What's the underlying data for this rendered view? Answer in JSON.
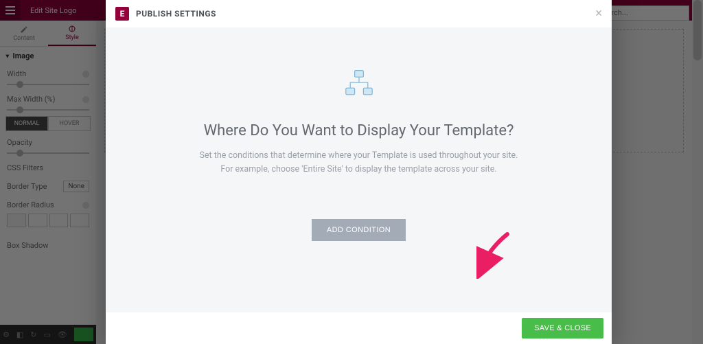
{
  "editor": {
    "title": "Edit Site Logo",
    "tabs": {
      "content": "Content",
      "style": "Style"
    },
    "section_image": "Image",
    "width_label": "Width",
    "max_width_label": "Max Width (%)",
    "normal_tab": "NORMAL",
    "hover_tab": "HOVER",
    "opacity_label": "Opacity",
    "css_filters_label": "CSS Filters",
    "border_type_label": "Border Type",
    "border_type_value": "None",
    "border_radius_label": "Border Radius",
    "box_shadow_label": "Box Shadow",
    "search_placeholder": "Search..."
  },
  "modal": {
    "title": "PUBLISH SETTINGS",
    "headline": "Where Do You Want to Display Your Template?",
    "sub1": "Set the conditions that determine where your Template is used throughout your site.",
    "sub2": "For example, choose 'Entire Site' to display the template across your site.",
    "add_condition": "ADD CONDITION",
    "save_close": "SAVE & CLOSE"
  }
}
